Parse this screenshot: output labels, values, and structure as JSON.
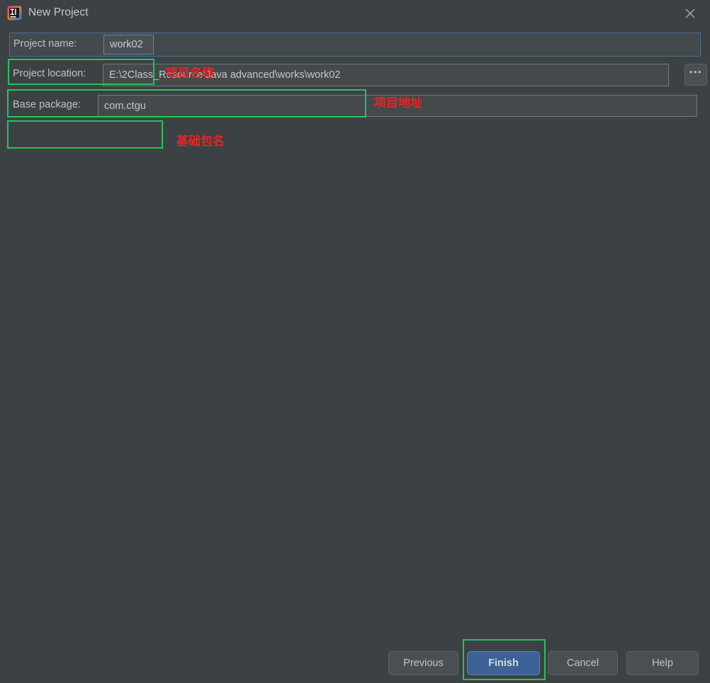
{
  "window": {
    "title": "New Project",
    "app_icon": "intellij-idea-logo",
    "close_icon": "close-icon"
  },
  "form": {
    "fields": [
      {
        "label": "Project name:",
        "value": "work02",
        "annotation": "项目名称",
        "focused": true
      },
      {
        "label": "Project location:",
        "value": "E:\\2Class_Resource\\Java advanced\\works\\work02",
        "annotation": "项目地址",
        "focused": false
      },
      {
        "label": "Base package:",
        "value": "com.ctgu",
        "annotation": "基础包名",
        "focused": false
      }
    ],
    "browse_label": "•••"
  },
  "buttons": {
    "previous": "Previous",
    "finish": "Finish",
    "cancel": "Cancel",
    "help": "Help"
  },
  "colors": {
    "dialog_background": "#3c4144",
    "field_background": "#44494c",
    "text": "#c4c7c9",
    "focus_border": "#5c85b4",
    "primary_button": "#3c6296",
    "annotation_box": "#22c55e",
    "annotation_text": "#ee2222"
  }
}
